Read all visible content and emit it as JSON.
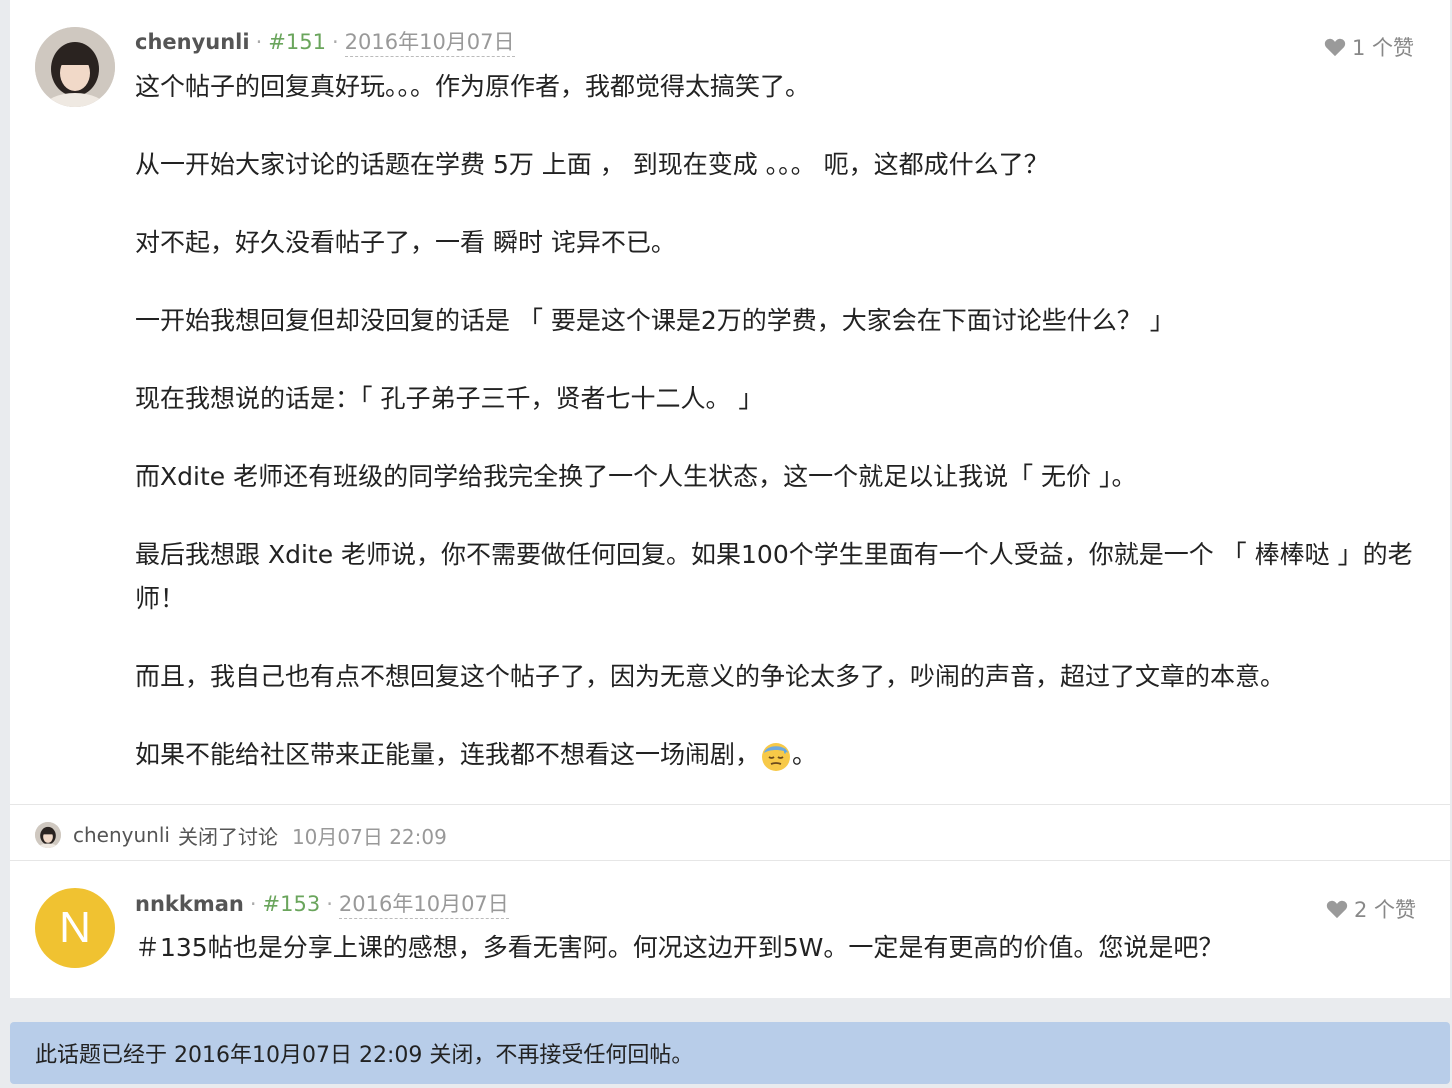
{
  "post1": {
    "username": "chenyunli",
    "post_number": "#151",
    "date": "2016年10月07日",
    "likes": "1 个赞",
    "paragraphs": [
      "这个帖子的回复真好玩。。。作为原作者，我都觉得太搞笑了。",
      "从一开始大家讨论的话题在学费 5万 上面 ， 到现在变成 。。。 呃，这都成什么了？",
      "对不起，好久没看帖子了，一看 瞬时 诧异不已。",
      "一开始我想回复但却没回复的话是 「 要是这个课是2万的学费，大家会在下面讨论些什么？ 」",
      "现在我想说的话是：「 孔子弟子三千，贤者七十二人。 」",
      "而Xdite 老师还有班级的同学给我完全换了一个人生状态，这一个就足以让我说「 无价 」。",
      "最后我想跟 Xdite 老师说，你不需要做任何回复。如果100个学生里面有一个人受益，你就是一个 「 棒棒哒 」的老师！",
      "而且，我自己也有点不想回复这个帖子了，因为无意义的争论太多了，吵闹的声音，超过了文章的本意。",
      "如果不能给社区带来正能量，连我都不想看这一场闹剧，",
      "。"
    ],
    "emoji_icon": "sweat-face-icon"
  },
  "action": {
    "username": "chenyunli",
    "text": "关闭了讨论",
    "time": "10月07日 22:09"
  },
  "post2": {
    "avatar_letter": "N",
    "avatar_color": "#f0c231",
    "username": "nnkkman",
    "post_number": "#153",
    "date": "2016年10月07日",
    "likes": "2 个赞",
    "text": "＃135帖也是分享上课的感想，多看无害阿。何况这边开到5W。一定是有更高的价值。您说是吧？"
  },
  "notice": {
    "text": "此话题已经于 2016年10月07日 22:09 关闭，不再接受任何回帖。",
    "color": "#b8cde9"
  }
}
